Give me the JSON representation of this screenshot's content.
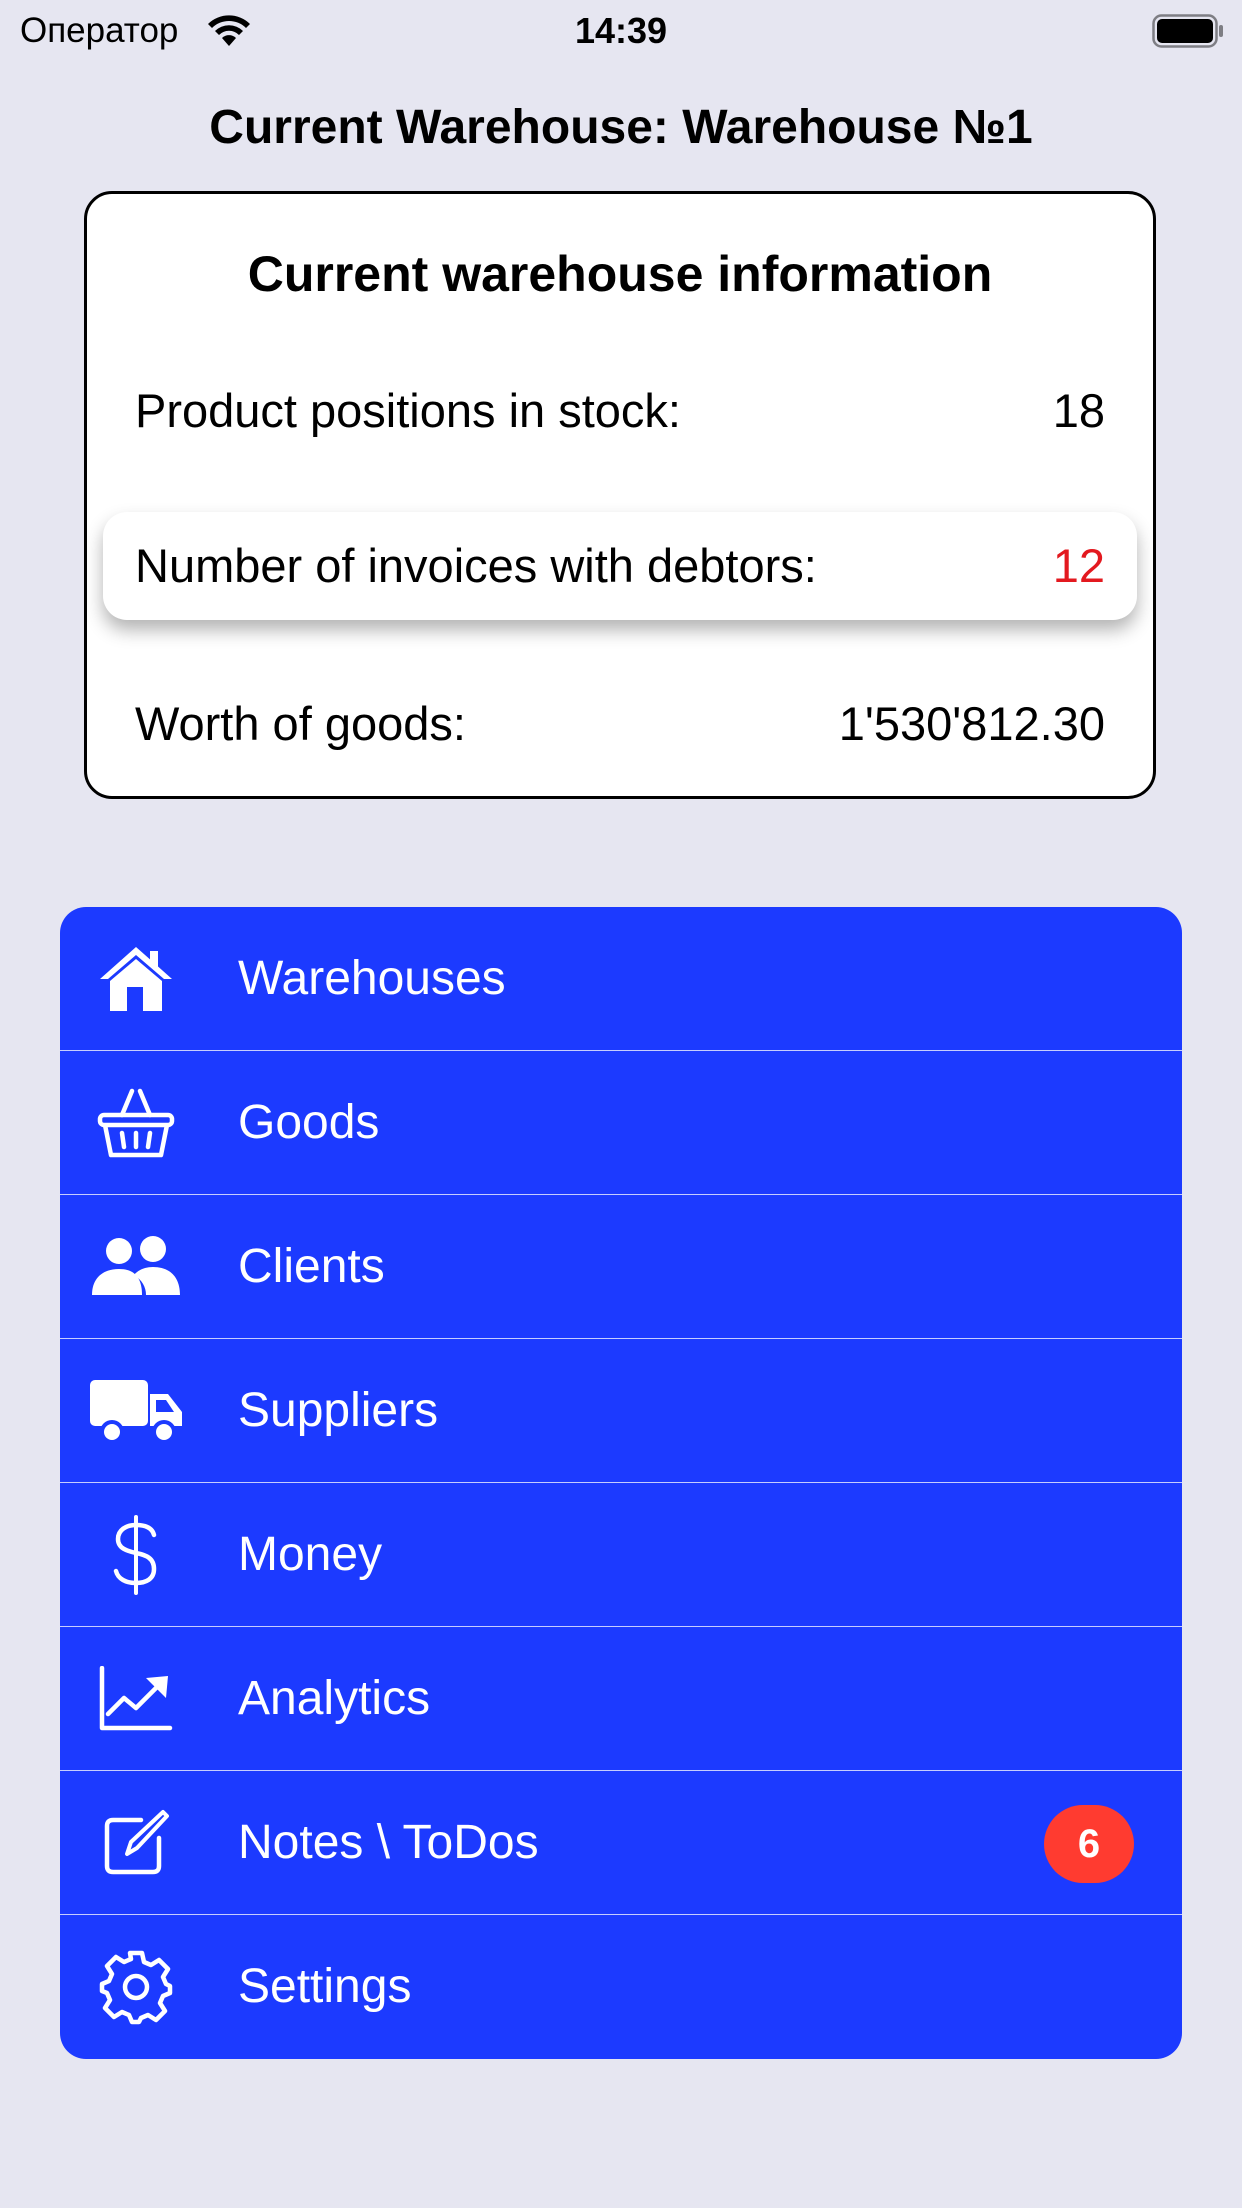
{
  "status_bar": {
    "carrier": "Оператор",
    "time": "14:39"
  },
  "header": {
    "title": "Current Warehouse: Warehouse №1"
  },
  "info_card": {
    "title": "Current warehouse information",
    "rows": [
      {
        "label": "Product positions in stock:",
        "value": "18"
      },
      {
        "label": "Number of invoices with debtors:",
        "value": "12"
      },
      {
        "label": "Worth of goods:",
        "value": "1'530'812.30"
      }
    ]
  },
  "menu": {
    "items": [
      {
        "label": "Warehouses",
        "icon": "house-icon"
      },
      {
        "label": "Goods",
        "icon": "basket-icon"
      },
      {
        "label": "Clients",
        "icon": "people-icon"
      },
      {
        "label": "Suppliers",
        "icon": "truck-icon"
      },
      {
        "label": "Money",
        "icon": "dollar-icon"
      },
      {
        "label": "Analytics",
        "icon": "chart-icon"
      },
      {
        "label": "Notes \\ ToDos",
        "icon": "edit-icon",
        "badge": "6"
      },
      {
        "label": "Settings",
        "icon": "gear-icon"
      }
    ]
  },
  "colors": {
    "background": "#e6e6f1",
    "menu_blue": "#1c3aff",
    "debt_red": "#e3191f",
    "badge_red": "#ff3b30"
  }
}
